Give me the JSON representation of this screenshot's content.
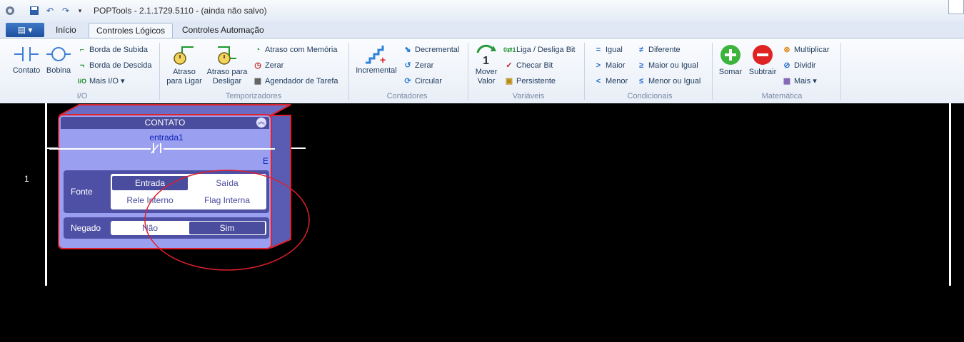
{
  "window": {
    "title": "POPTools - 2.1.1729.5110 - (ainda não salvo)"
  },
  "tabs": [
    {
      "label": "Início"
    },
    {
      "label": "Controles Lógicos"
    },
    {
      "label": "Controles Automação"
    }
  ],
  "ribbon": {
    "io": {
      "label": "I/O",
      "contato": "Contato",
      "bobina": "Bobina",
      "borda_subida": "Borda de Subida",
      "borda_descida": "Borda de Descida",
      "mais_io": "Mais I/O"
    },
    "temporizadores": {
      "label": "Temporizadores",
      "atraso_ligar": [
        "Atraso",
        "para Ligar"
      ],
      "atraso_desligar": [
        "Atraso para",
        "Desligar"
      ],
      "atraso_memoria": "Atraso com Memória",
      "zerar": "Zerar",
      "agendador": "Agendador de Tarefa"
    },
    "contadores": {
      "label": "Contadores",
      "incremental": "Incremental",
      "decremental": "Decremental",
      "zerar": "Zerar",
      "circular": "Circular"
    },
    "variaveis": {
      "label": "Variáveis",
      "mover_valor": [
        "Mover",
        "Valor"
      ],
      "liga_desliga": "Liga / Desliga Bit",
      "checar_bit": "Checar Bit",
      "persistente": "Persistente"
    },
    "condicionais": {
      "label": "Condicionais",
      "igual": "Igual",
      "maior": "Maior",
      "menor": "Menor",
      "diferente": "Diferente",
      "maior_igual": "Maior ou Igual",
      "menor_igual": "Menor ou Igual"
    },
    "matematica": {
      "label": "Matemática",
      "somar": "Somar",
      "subtrair": "Subtrair",
      "multiplicar": "Multiplicar",
      "dividir": "Dividir",
      "mais": "Mais"
    }
  },
  "ladder": {
    "row_number": "1",
    "contact": {
      "header": "CONTATO",
      "name": "entrada1",
      "type_letter": "E",
      "fonte_label": "Fonte",
      "fonte_options": [
        "Entrada",
        "Saída",
        "Rele Interno",
        "Flag Interna"
      ],
      "fonte_selected": "Entrada",
      "negado_label": "Negado",
      "negado_options": [
        "Não",
        "Sim"
      ],
      "negado_selected": "Sim"
    }
  },
  "colors": {
    "panel_bg": "#9aa0ef",
    "panel_header": "#4a4c9e",
    "highlight_red": "#e0202c",
    "contact_text": "#0c1fb8"
  }
}
